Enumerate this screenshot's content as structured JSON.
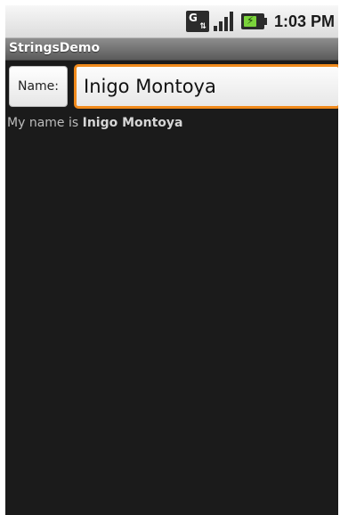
{
  "status_bar": {
    "data_icon": "data-3g-icon",
    "data_icon_letter": "G",
    "signal_icon": "signal-strength-icon",
    "battery_icon": "battery-charging-icon",
    "time": "1:03 PM"
  },
  "app": {
    "title": "StringsDemo"
  },
  "form": {
    "name_label": "Name:",
    "name_value": "Inigo Montoya"
  },
  "message": {
    "prefix": "My name is ",
    "name": "Inigo Montoya"
  },
  "colors": {
    "background": "#1b1b1b",
    "focus_orange": "#f08a1c",
    "title_bar": "#6e6e6e"
  }
}
